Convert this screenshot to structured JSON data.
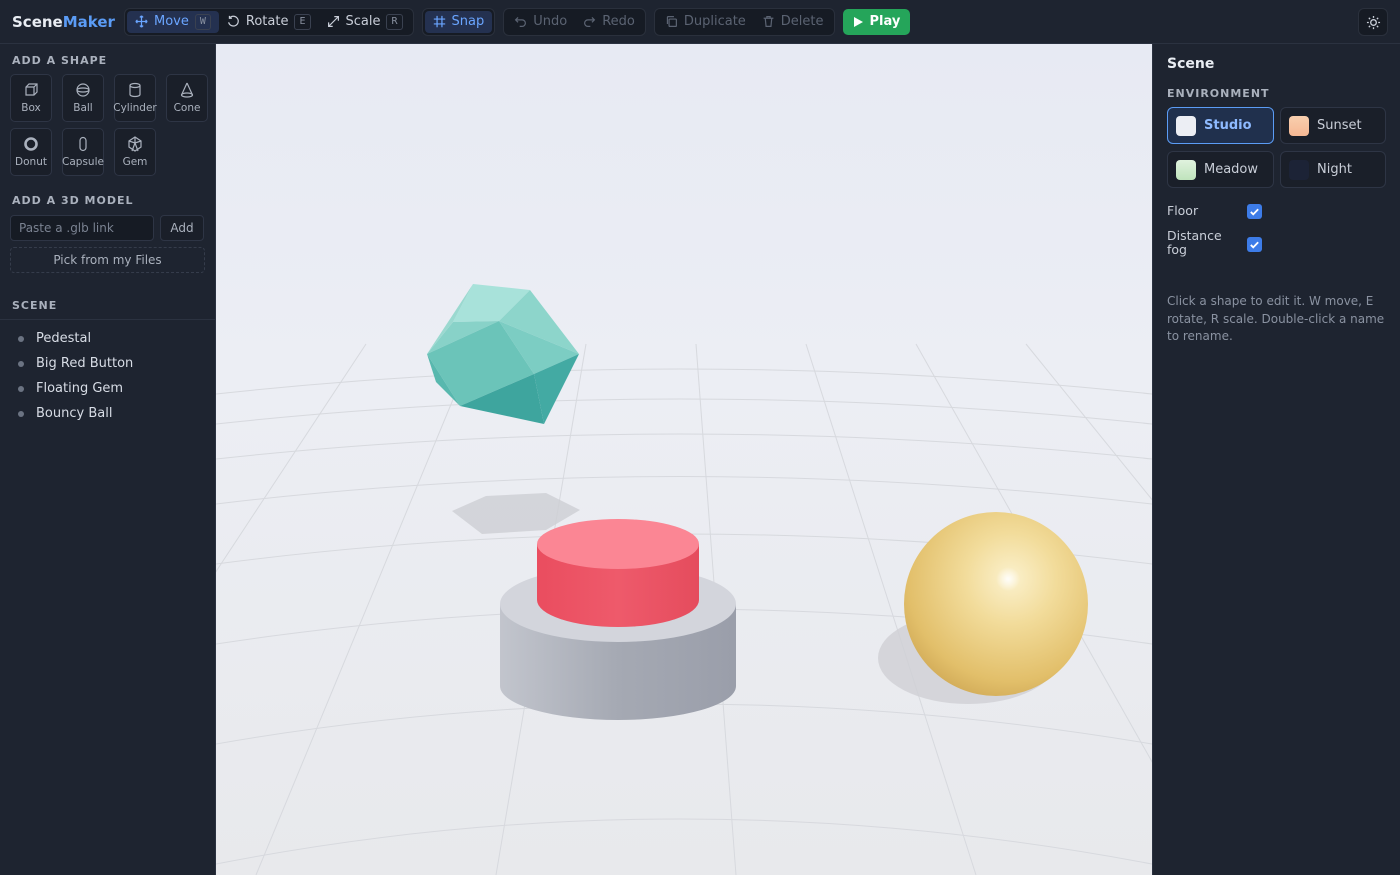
{
  "app": {
    "brand_part1": "Scene",
    "brand_part2": "Maker"
  },
  "toolbar": {
    "move": {
      "label": "Move",
      "key": "W"
    },
    "rotate": {
      "label": "Rotate",
      "key": "E"
    },
    "scale": {
      "label": "Scale",
      "key": "R"
    },
    "snap": "Snap",
    "undo": "Undo",
    "redo": "Redo",
    "duplicate": "Duplicate",
    "delete": "Delete",
    "play": "Play",
    "active_tool": "Move",
    "theme_icon": "sun-icon"
  },
  "left": {
    "add_shape_title": "ADD A SHAPE",
    "shapes": [
      {
        "label": "Box",
        "icon": "box-icon"
      },
      {
        "label": "Ball",
        "icon": "ball-icon"
      },
      {
        "label": "Cylinder",
        "icon": "cylinder-icon"
      },
      {
        "label": "Cone",
        "icon": "cone-icon"
      },
      {
        "label": "Donut",
        "icon": "donut-icon"
      },
      {
        "label": "Capsule",
        "icon": "capsule-icon"
      },
      {
        "label": "Gem",
        "icon": "gem-icon"
      }
    ],
    "add_model_title": "ADD A 3D MODEL",
    "glb_placeholder": "Paste a .glb link",
    "add_label": "Add",
    "pick_label": "Pick from my Files",
    "scene_title": "SCENE",
    "scene_items": [
      "Pedestal",
      "Big Red Button",
      "Floating Gem",
      "Bouncy Ball"
    ]
  },
  "right": {
    "title": "Scene",
    "environment_title": "ENVIRONMENT",
    "environments": [
      {
        "label": "Studio",
        "color": "#eceef4",
        "active": true
      },
      {
        "label": "Sunset",
        "color": "#f8cfae",
        "active": false
      },
      {
        "label": "Meadow",
        "color": "#d3ecd2",
        "active": false
      },
      {
        "label": "Night",
        "color": "#1c2336",
        "active": false
      }
    ],
    "floor_label": "Floor",
    "floor_checked": true,
    "fog_label_1": "Distance",
    "fog_label_2": "fog",
    "fog_checked": true,
    "help": "Click a shape to edit it. W move, E rotate, R scale. Double-click a name to rename."
  },
  "colors": {
    "accent": "#5b9cf5",
    "play": "#25a55a",
    "gem": "#5fc6be",
    "button_red": "#ee5a6b",
    "pedestal": "#a9adb8",
    "ball": "#edd08a"
  }
}
